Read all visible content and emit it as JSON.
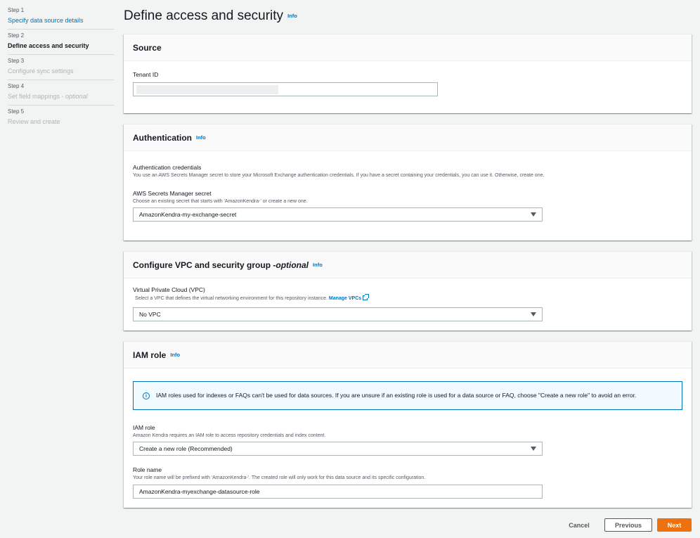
{
  "steps": [
    {
      "num": "Step 1",
      "label": "Specify data source details",
      "optional": ""
    },
    {
      "num": "Step 2",
      "label": "Define access and security",
      "optional": ""
    },
    {
      "num": "Step 3",
      "label": "Configure sync settings",
      "optional": ""
    },
    {
      "num": "Step 4",
      "label": "Set field mappings - ",
      "optional": "optional"
    },
    {
      "num": "Step 5",
      "label": "Review and create",
      "optional": ""
    }
  ],
  "page": {
    "title": "Define access and security",
    "info": "Info"
  },
  "source": {
    "title": "Source",
    "tenant_label": "Tenant ID",
    "tenant_value": ""
  },
  "auth": {
    "title": "Authentication",
    "info": "Info",
    "cred_label": "Authentication credentials",
    "cred_desc": "You use an AWS Secrets Manager secret to store your Microsoft Exchange authentication credentials. If you have a secret containing your credentials, you can use it. Otherwise, create one.",
    "secret_label": "AWS Secrets Manager secret",
    "secret_desc": "Choose an existing secret that starts with 'AmazonKendra-' or create a new one.",
    "secret_value": "AmazonKendra-my-exchange-secret"
  },
  "vpc": {
    "title": "Configure VPC and security group - ",
    "title_optional": "optional",
    "info": "Info",
    "label": "Virtual Private Cloud (VPC)",
    "desc": "Select a VPC that defines the virtual networking environment for this repository instance.",
    "manage_link": "Manage VPCs",
    "value": "No VPC"
  },
  "iam": {
    "title": "IAM role",
    "info": "Info",
    "alert": "IAM roles used for indexes or FAQs can't be used for data sources. If you are unsure if an existing role is used for a data source or FAQ, choose \"Create a new role\" to avoid an error.",
    "role_label": "IAM role",
    "role_desc": "Amazon Kendra requires an IAM role to access repository credentials and index content.",
    "role_value": "Create a new role (Recommended)",
    "name_label": "Role name",
    "name_desc": "Your role name will be prefixed with 'AmazonKendra-'. The created role will only work for this data source and its specific configuration.",
    "name_value": "AmazonKendra-myexchange-datasource-role"
  },
  "footer": {
    "cancel": "Cancel",
    "previous": "Previous",
    "next": "Next"
  },
  "colors": {
    "accent": "#0073bb",
    "primary_button": "#ec7211"
  }
}
